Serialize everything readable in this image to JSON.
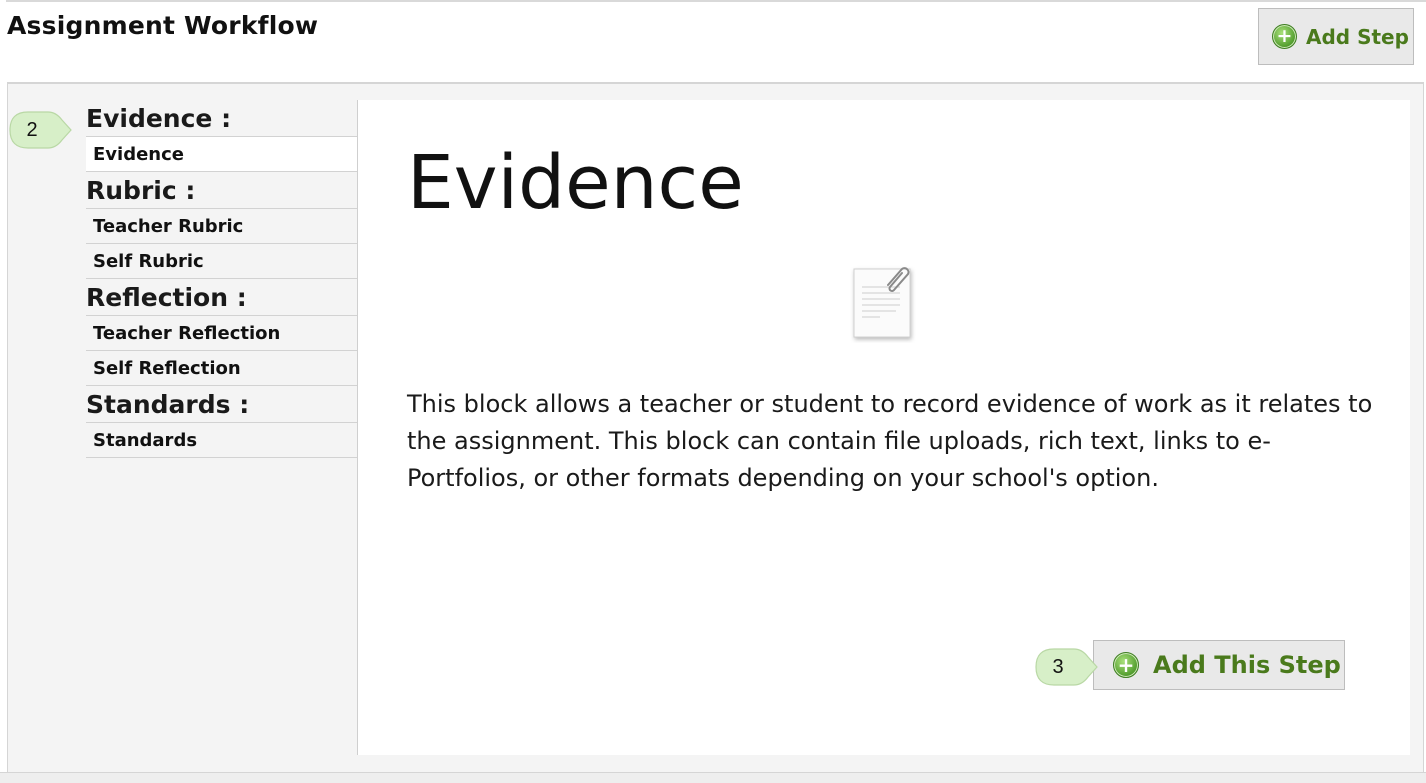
{
  "header": {
    "title": "Assignment Workflow",
    "add_step_label": "Add Step"
  },
  "sidebar": {
    "groups": [
      {
        "label": "Evidence :",
        "items": [
          {
            "label": "Evidence",
            "active": true
          }
        ]
      },
      {
        "label": "Rubric :",
        "items": [
          {
            "label": "Teacher Rubric"
          },
          {
            "label": "Self Rubric"
          }
        ]
      },
      {
        "label": "Reflection :",
        "items": [
          {
            "label": "Teacher Reflection"
          },
          {
            "label": "Self Reflection"
          }
        ]
      },
      {
        "label": "Standards :",
        "items": [
          {
            "label": "Standards"
          }
        ]
      }
    ]
  },
  "content": {
    "title": "Evidence",
    "icon": "document-paperclip-icon",
    "description": "This block allows a teacher or student to record evidence of work as it relates to the assignment. This block can contain file uploads, rich text, links to e-Portfolios, or other formats depending on your school's option.",
    "add_this_step_label": "Add This Step"
  },
  "callouts": {
    "sidebar_marker": "2",
    "button_marker": "3"
  },
  "colors": {
    "button_text": "#4a7a1c",
    "button_bg": "#e9e9e9",
    "callout_fill": "#d7efc8",
    "panel_bg": "#f4f4f4"
  }
}
